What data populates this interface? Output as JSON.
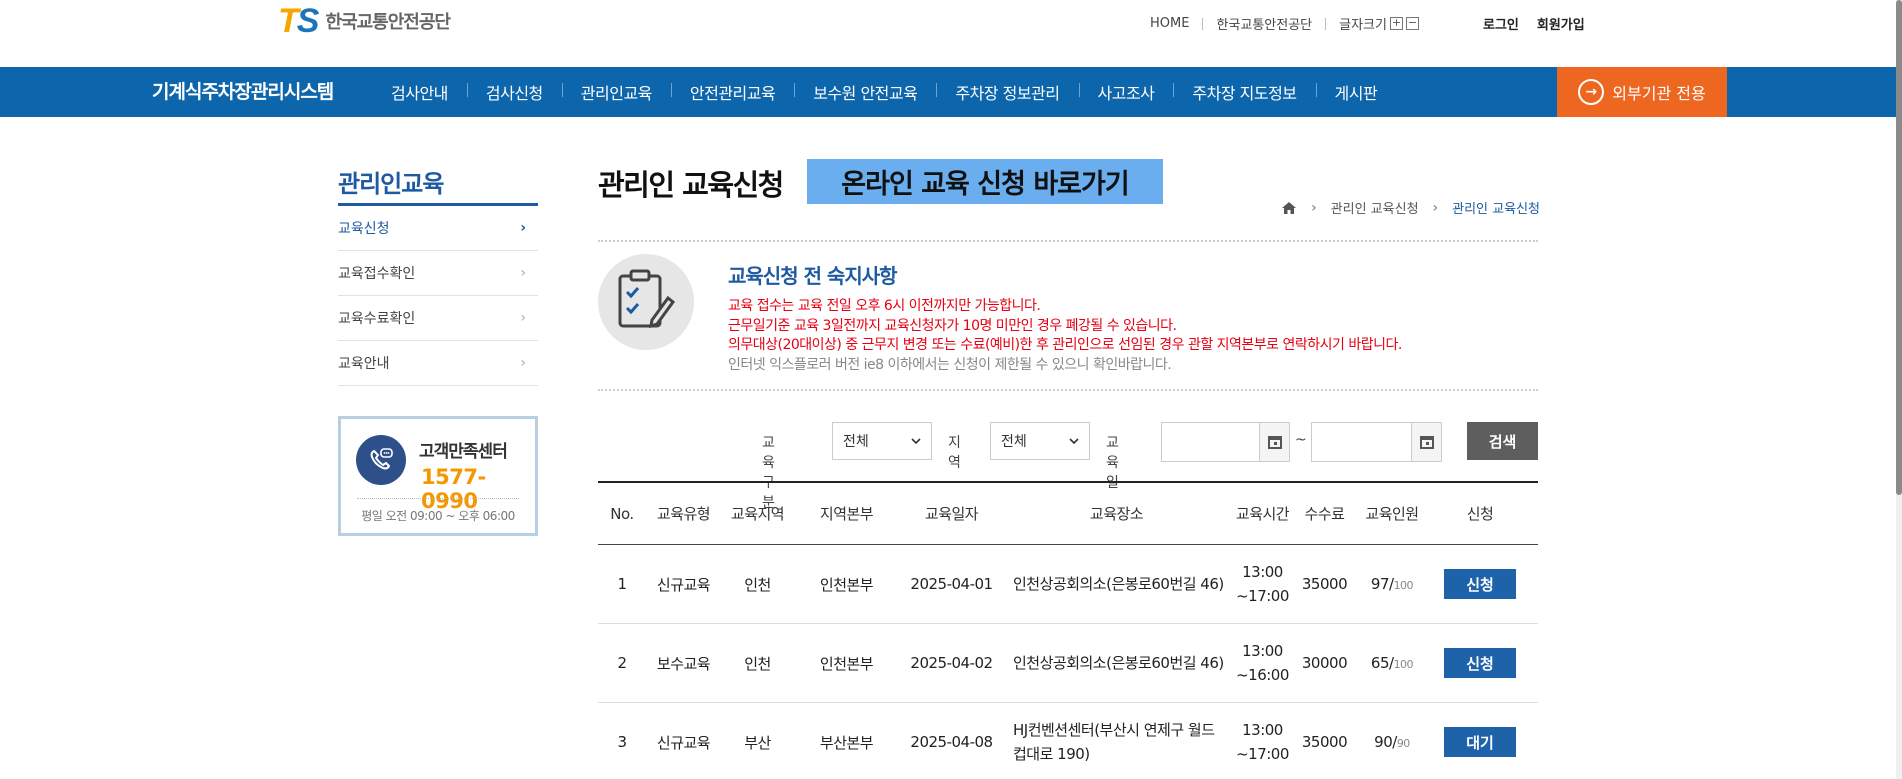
{
  "header": {
    "logo_mark_t": "T",
    "logo_mark_s": "S",
    "logo_name": "한국교통안전공단",
    "util_links": [
      "HOME",
      "한국교통안전공단"
    ],
    "font_size_label": "글자크기",
    "font_plus": "+",
    "font_minus": "−",
    "login": "로그인",
    "signup": "회원가입"
  },
  "nav": {
    "title": "기계식주차장관리시스템",
    "items": [
      "검사안내",
      "검사신청",
      "관리인교육",
      "안전관리교육",
      "보수원 안전교육",
      "주차장 정보관리",
      "사고조사",
      "주차장 지도정보",
      "게시판"
    ],
    "external_button": "외부기관 전용"
  },
  "sidebar": {
    "title": "관리인교육",
    "items": [
      {
        "label": "교육신청"
      },
      {
        "label": "교육접수확인"
      },
      {
        "label": "교육수료확인"
      },
      {
        "label": "교육안내"
      }
    ],
    "chevron": "›",
    "cs": {
      "label": "고객만족센터",
      "phone": "1577-0990",
      "hours": "평일 오전 09:00 ~ 오후 06:00"
    }
  },
  "main": {
    "title": "관리인 교육신청",
    "online_button": "온라인 교육 신청 바로가기",
    "breadcrumb": [
      "관리인 교육신청",
      "관리인 교육신청"
    ],
    "breadcrumb_sep": "›",
    "notice": {
      "title": "교육신청 전 숙지사항",
      "lines_red": [
        "교육 접수는 교육 전일 오후 6시 이전까지만 가능합니다.",
        "근무일기준 교육 3일전까지 교육신청자가 10명 미만인 경우 폐강될 수 있습니다.",
        "의무대상(20대이상) 중 근무지 변경 또는 수료(예비)한 후 관리인으로 선임된 경우 관할 지역본부로 연락하시기 바랍니다."
      ],
      "line_gray": "인터넷 익스플로러 버전 ie8 이하에서는 신청이 제한될 수 있으니 확인바랍니다."
    },
    "filter": {
      "type_label": "교육구분",
      "type_value": "전체",
      "region_label": "지역",
      "region_value": "전체",
      "date_label": "교육일",
      "date_from": "",
      "date_to": "",
      "tilde": "~",
      "search": "검색"
    },
    "table": {
      "headers": [
        "No.",
        "교육유형",
        "교육지역",
        "지역본부",
        "교육일자",
        "교육장소",
        "교육시간",
        "수수료",
        "교육인원",
        "신청"
      ],
      "rows": [
        {
          "no": "1",
          "type": "신규교육",
          "region": "인천",
          "hq": "인천본부",
          "date": "2025-04-01",
          "place1": "인천상공회의소(은봉로60번길 46)",
          "place2": "",
          "time1": "13:00",
          "time2": "~17:00",
          "fee": "35000",
          "count": "97/",
          "cap": "100",
          "action": "신청"
        },
        {
          "no": "2",
          "type": "보수교육",
          "region": "인천",
          "hq": "인천본부",
          "date": "2025-04-02",
          "place1": "인천상공회의소(은봉로60번길 46)",
          "place2": "",
          "time1": "13:00",
          "time2": "~16:00",
          "fee": "30000",
          "count": "65/",
          "cap": "100",
          "action": "신청"
        },
        {
          "no": "3",
          "type": "신규교육",
          "region": "부산",
          "hq": "부산본부",
          "date": "2025-04-08",
          "place1": "HJ컨벤션센터(부산시 연제구 월드",
          "place2": "컵대로 190)",
          "time1": "13:00",
          "time2": "~17:00",
          "fee": "35000",
          "count": "90/",
          "cap": "90",
          "action": "대기"
        }
      ]
    }
  },
  "colors": {
    "nav_bg": "#0d66ac",
    "external_btn": "#ee6721",
    "accent_blue": "#1e5aa1",
    "online_btn": "#6aaef0",
    "notice_red": "#e60012",
    "phone_orange": "#f39800"
  }
}
